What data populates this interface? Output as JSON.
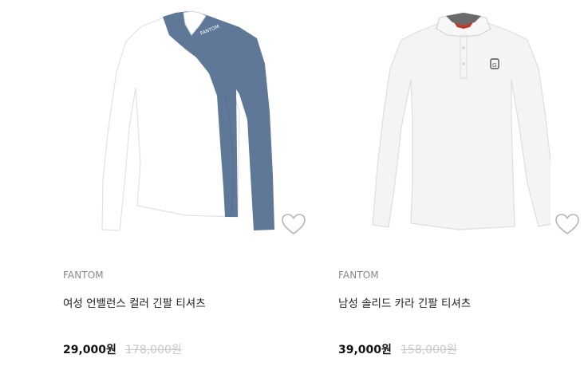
{
  "products": [
    {
      "brand": "FANTOM",
      "name": "여성 언밸런스 컬러 긴팔 티셔츠",
      "price": "29,000원",
      "original_price": "178,000원",
      "image_icon": "womens-unbalance-color-longsleeve-shirt",
      "colors": {
        "body": "#ffffff",
        "accent": "#5f7898"
      }
    },
    {
      "brand": "FANTOM",
      "name": "남성 솔리드 카라 긴팔 티셔츠",
      "price": "39,000원",
      "original_price": "158,000원",
      "image_icon": "mens-solid-collar-longsleeve-shirt",
      "colors": {
        "body": "#f4f4f4",
        "accent": "#c0392b"
      }
    }
  ],
  "heart_icon": "heart-outline-icon"
}
